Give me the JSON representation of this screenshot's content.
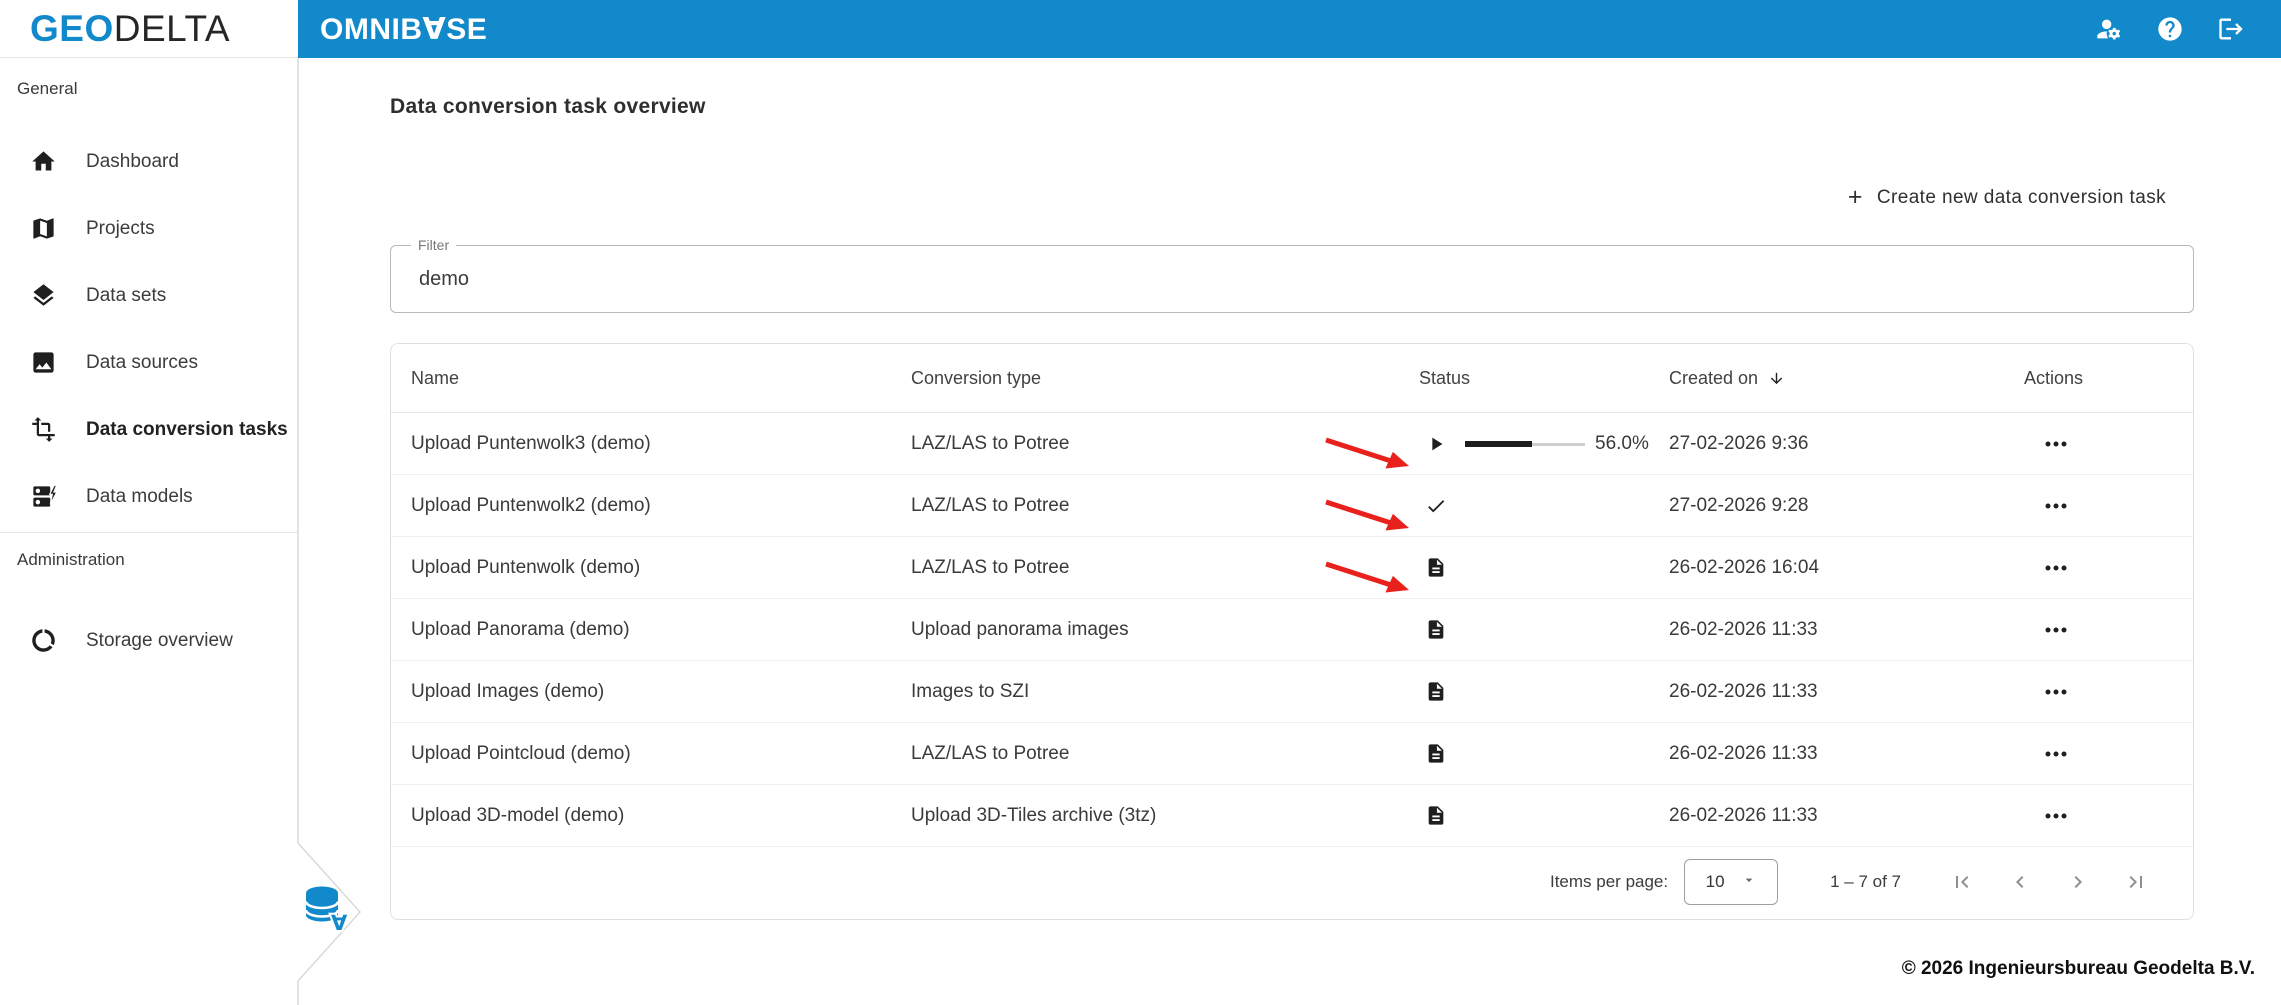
{
  "brand": {
    "geo": "GEO",
    "delta": "DELTA",
    "app_name": "OMNIB∀SE"
  },
  "colors": {
    "brand_blue": "#1289CA",
    "annotation_red": "#E8211D",
    "icon_dark": "#1f1f1f"
  },
  "topbar": {
    "icons": [
      "manage-accounts-icon",
      "help-icon",
      "logout-icon"
    ]
  },
  "sidebar": {
    "sections": [
      {
        "label": "General",
        "items": [
          {
            "label": "Dashboard",
            "icon": "home-icon",
            "active": false
          },
          {
            "label": "Projects",
            "icon": "map-icon",
            "active": false
          },
          {
            "label": "Data sets",
            "icon": "layers-icon",
            "active": false
          },
          {
            "label": "Data sources",
            "icon": "image-icon",
            "active": false
          },
          {
            "label": "Data conversion tasks",
            "icon": "transform-icon",
            "active": true
          },
          {
            "label": "Data models",
            "icon": "storage-bolt-icon",
            "active": false
          }
        ]
      },
      {
        "label": "Administration",
        "items": [
          {
            "label": "Storage overview",
            "icon": "donut-chart-icon",
            "active": false
          }
        ]
      }
    ],
    "bottom_badge_icon": "database-icon"
  },
  "main": {
    "title": "Data conversion task overview",
    "create_button": {
      "plus_glyph": "+",
      "label": "Create new data conversion task"
    },
    "filter": {
      "label": "Filter",
      "value": "demo"
    },
    "table": {
      "columns": [
        "Name",
        "Conversion type",
        "Status",
        "Created on",
        "Actions"
      ],
      "sorted_by": "Created on",
      "sort_direction": "descending",
      "rows": [
        {
          "name": "Upload Puntenwolk3 (demo)",
          "type": "LAZ/LAS to Potree",
          "status": "running",
          "status_icon": "play-icon",
          "progress": {
            "percent": 56,
            "label": "56.0%"
          },
          "created": "27-02-2026 9:36",
          "annotation_arrow": true
        },
        {
          "name": "Upload Puntenwolk2 (demo)",
          "type": "LAZ/LAS to Potree",
          "status": "completed",
          "status_icon": "check-icon",
          "created": "27-02-2026 9:28",
          "annotation_arrow": true
        },
        {
          "name": "Upload Puntenwolk (demo)",
          "type": "LAZ/LAS to Potree",
          "status": "created",
          "status_icon": "document-icon",
          "created": "26-02-2026 16:04",
          "annotation_arrow": true
        },
        {
          "name": "Upload Panorama (demo)",
          "type": "Upload panorama images",
          "status": "created",
          "status_icon": "document-icon",
          "created": "26-02-2026 11:33",
          "annotation_arrow": false
        },
        {
          "name": "Upload Images (demo)",
          "type": "Images to SZI",
          "status": "created",
          "status_icon": "document-icon",
          "created": "26-02-2026 11:33",
          "annotation_arrow": false
        },
        {
          "name": "Upload Pointcloud (demo)",
          "type": "LAZ/LAS to Potree",
          "status": "created",
          "status_icon": "document-icon",
          "created": "26-02-2026 11:33",
          "annotation_arrow": false
        },
        {
          "name": "Upload 3D-model (demo)",
          "type": "Upload 3D-Tiles archive (3tz)",
          "status": "created",
          "status_icon": "document-icon",
          "created": "26-02-2026 11:33",
          "annotation_arrow": false
        }
      ],
      "pagination": {
        "items_per_page_label": "Items per page:",
        "items_per_page": "10",
        "range": "1 – 7 of 7",
        "nav_icons": [
          "first-page-icon",
          "prev-page-icon",
          "next-page-icon",
          "last-page-icon"
        ]
      }
    },
    "footer": "© 2026 Ingenieursbureau Geodelta B.V."
  }
}
